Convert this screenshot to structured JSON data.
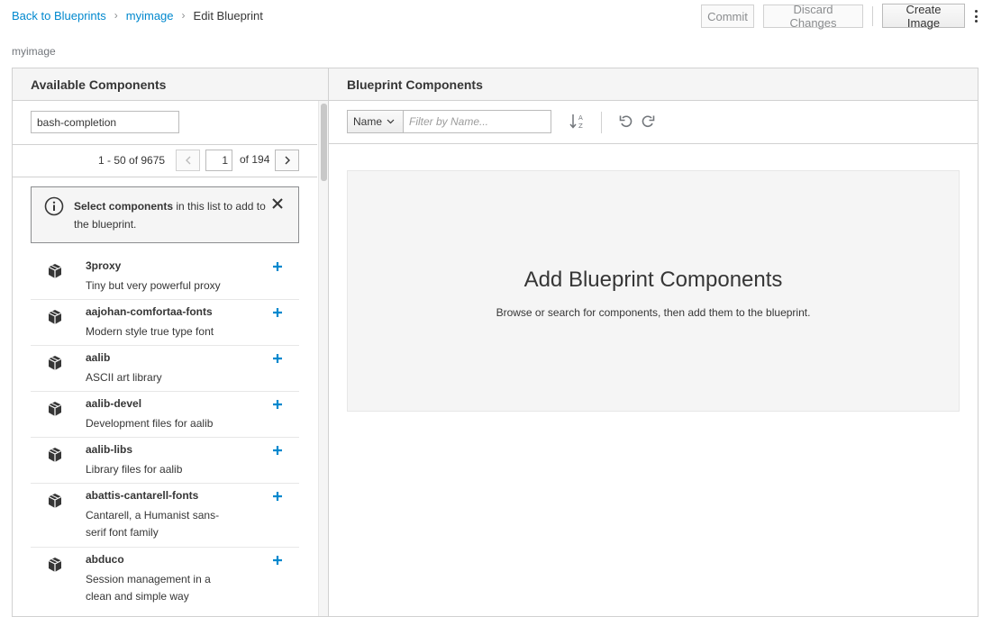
{
  "breadcrumb": {
    "back_label": "Back to Blueprints",
    "blueprint_label": "myimage",
    "current_label": "Edit Blueprint"
  },
  "header": {
    "commit_label": "Commit",
    "discard_label": "Discard Changes",
    "create_image_label": "Create Image",
    "image_name": "myimage"
  },
  "available": {
    "title": "Available Components",
    "search_value": "bash-completion",
    "pager": {
      "range": "1 - 50 of 9675",
      "page": "1",
      "total": "of 194"
    },
    "alert": {
      "bold": "Select components",
      "text": " in this list to add to the blueprint."
    },
    "items": [
      {
        "name": "3proxy",
        "desc": "Tiny but very powerful proxy"
      },
      {
        "name": "aajohan-comfortaa-fonts",
        "desc": "Modern style true type font"
      },
      {
        "name": "aalib",
        "desc": "ASCII art library"
      },
      {
        "name": "aalib-devel",
        "desc": "Development files for aalib"
      },
      {
        "name": "aalib-libs",
        "desc": "Library files for aalib"
      },
      {
        "name": "abattis-cantarell-fonts",
        "desc": "Cantarell, a Humanist sans-serif font family"
      },
      {
        "name": "abduco",
        "desc": "Session management in a clean and simple way"
      }
    ]
  },
  "blueprint": {
    "title": "Blueprint Components",
    "filter_select": "Name",
    "filter_placeholder": "Filter by Name...",
    "empty_title": "Add Blueprint Components",
    "empty_desc": "Browse or search for components, then add them to the blueprint."
  },
  "colors": {
    "link": "#0088ce",
    "text": "#363636",
    "border": "#d1d1d1",
    "panel_bg": "#f5f5f5"
  }
}
